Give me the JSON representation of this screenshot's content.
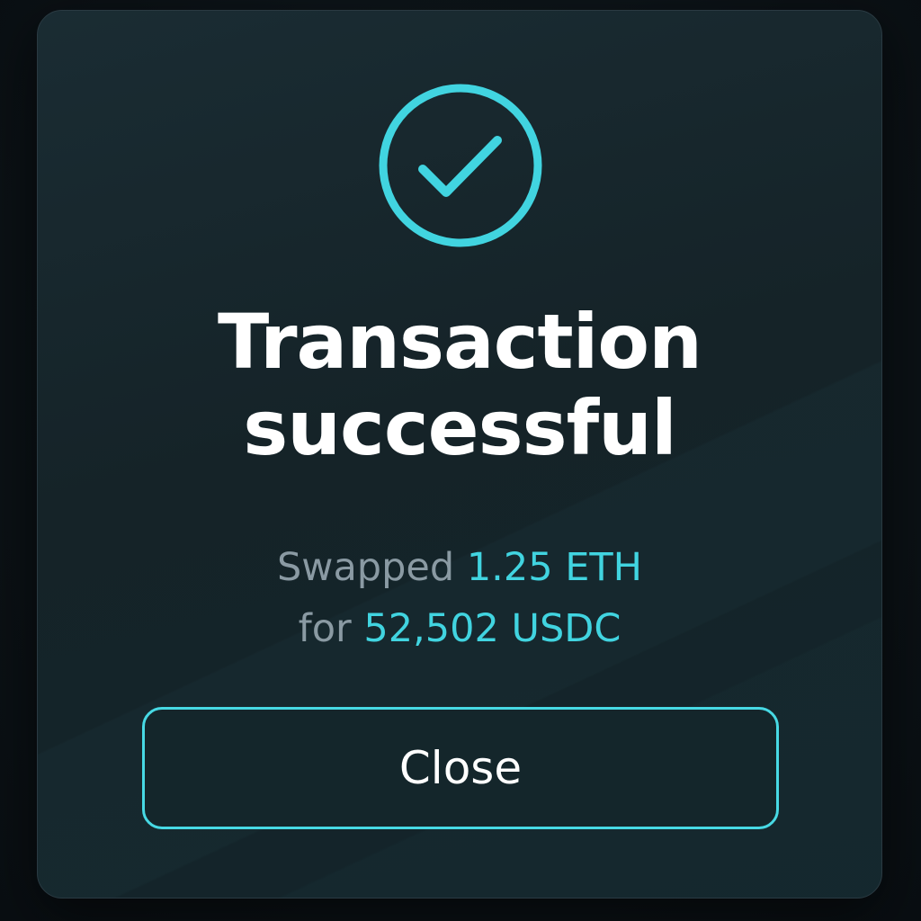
{
  "dialog": {
    "title_line1": "Transaction",
    "title_line2": "successful",
    "summary": {
      "swapped_word": "Swapped",
      "from_amount": "1.25 ETH",
      "for_word": "for",
      "to_amount": "52,502 USDC"
    },
    "close_label": "Close",
    "icon": "check-circle-icon"
  },
  "colors": {
    "accent": "#41d4e0",
    "title": "#ffffff",
    "muted_text": "#8a9aa3",
    "modal_bg": "#152328",
    "page_bg": "#0b1115"
  }
}
